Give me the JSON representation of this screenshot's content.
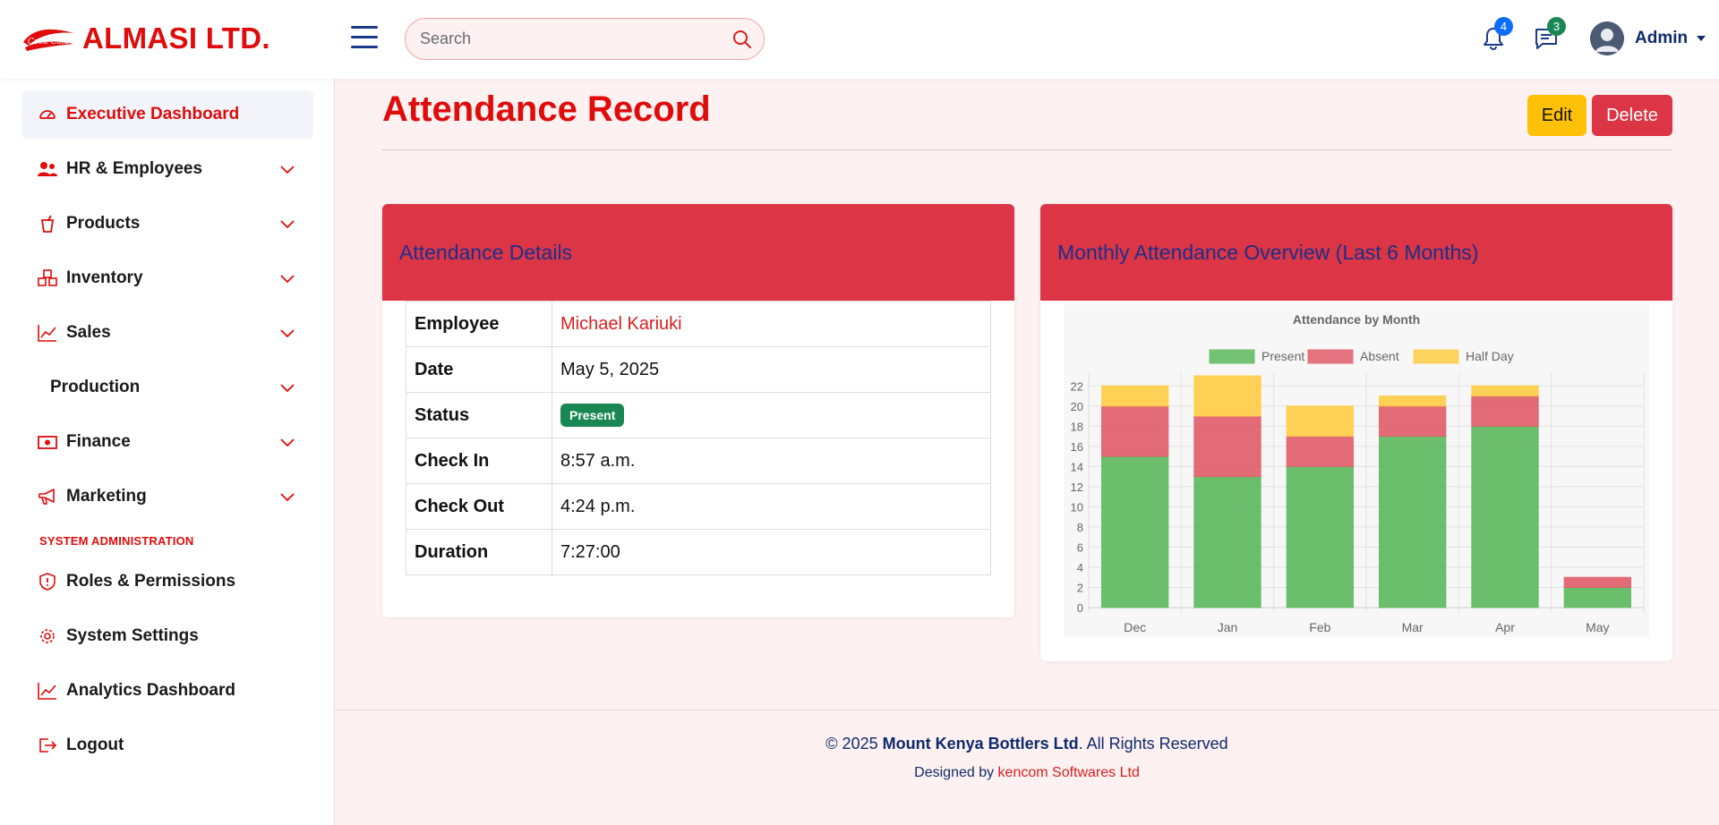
{
  "brand": {
    "name": "ALMASI LTD.",
    "logo_text": "Coca-Cola"
  },
  "header": {
    "search_placeholder": "Search",
    "notifications_count": "4",
    "messages_count": "3",
    "user_name": "Admin"
  },
  "sidebar": {
    "items": [
      {
        "label": "Executive Dashboard",
        "icon": "speedometer-icon",
        "active": true
      },
      {
        "label": "HR & Employees",
        "icon": "people-icon",
        "expandable": true
      },
      {
        "label": "Products",
        "icon": "cup-icon",
        "expandable": true
      },
      {
        "label": "Inventory",
        "icon": "boxes-icon",
        "expandable": true
      },
      {
        "label": "Sales",
        "icon": "trend-up-icon",
        "expandable": true
      },
      {
        "label": "Production",
        "icon": "",
        "expandable": true
      },
      {
        "label": "Finance",
        "icon": "cash-icon",
        "expandable": true
      },
      {
        "label": "Marketing",
        "icon": "megaphone-icon",
        "expandable": true
      }
    ],
    "section_title": "SYSTEM ADMINISTRATION",
    "admin_items": [
      {
        "label": "Roles & Permissions",
        "icon": "shield-icon"
      },
      {
        "label": "System Settings",
        "icon": "gear-icon"
      },
      {
        "label": "Analytics Dashboard",
        "icon": "line-chart-icon"
      },
      {
        "label": "Logout",
        "icon": "logout-icon"
      }
    ]
  },
  "page": {
    "title": "Attendance Record",
    "edit_label": "Edit",
    "delete_label": "Delete"
  },
  "details": {
    "heading": "Attendance Details",
    "rows": [
      {
        "label": "Employee",
        "value": "Michael Kariuki"
      },
      {
        "label": "Date",
        "value": "May 5, 2025"
      },
      {
        "label": "Status",
        "value": "Present"
      },
      {
        "label": "Check In",
        "value": "8:57 a.m."
      },
      {
        "label": "Check Out",
        "value": "4:24 p.m."
      },
      {
        "label": "Duration",
        "value": "7:27:00"
      }
    ]
  },
  "chart_card": {
    "heading": "Monthly Attendance Overview (Last 6 Months)"
  },
  "chart_data": {
    "type": "bar",
    "stacked": true,
    "title": "Attendance by Month",
    "categories": [
      "Dec",
      "Jan",
      "Feb",
      "Mar",
      "Apr",
      "May"
    ],
    "series": [
      {
        "name": "Present",
        "values": [
          15,
          13,
          14,
          17,
          18,
          2
        ],
        "color": "#5cb85c"
      },
      {
        "name": "Absent",
        "values": [
          5,
          6,
          3,
          3,
          3,
          1
        ],
        "color": "#e05c6a"
      },
      {
        "name": "Half Day",
        "values": [
          2,
          4,
          3,
          1,
          1,
          0
        ],
        "color": "#ffcd45"
      }
    ],
    "ylim": [
      0,
      23
    ],
    "yticks": [
      0,
      2,
      4,
      6,
      8,
      10,
      12,
      14,
      16,
      18,
      20,
      22
    ],
    "legend_position": "top",
    "grid": true
  },
  "footer": {
    "copyright_prefix": "© 2025 ",
    "company": "Mount Kenya Bottlers Ltd",
    "copyright_suffix": ". All Rights Reserved",
    "designed_prefix": "Designed by ",
    "designer": "kencom Softwares Ltd"
  }
}
